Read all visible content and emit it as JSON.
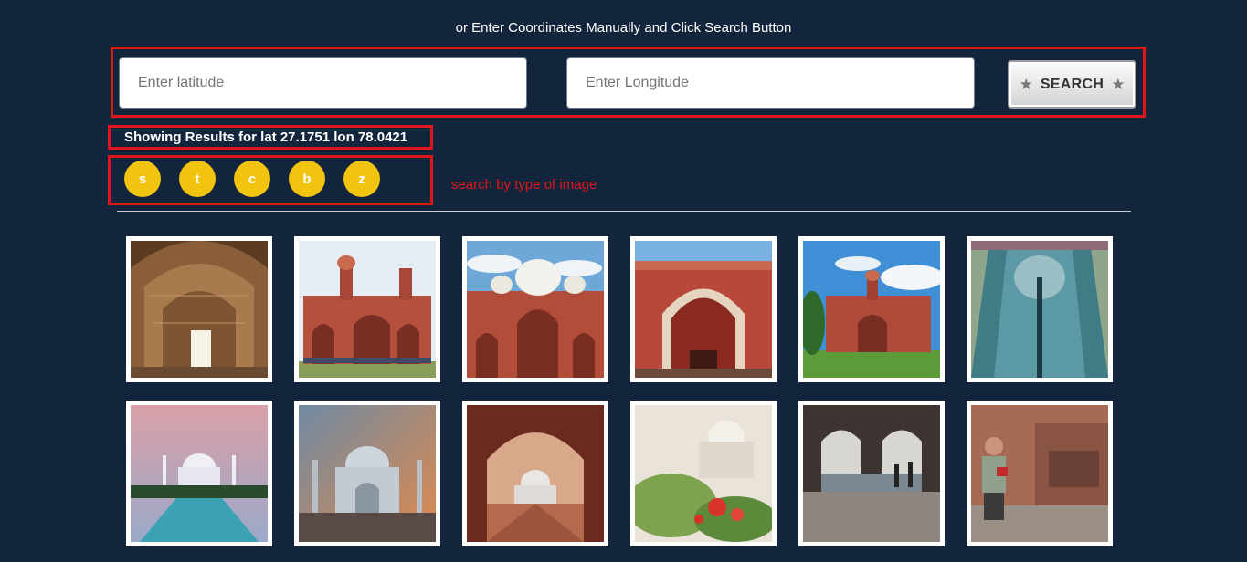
{
  "instruction": "or Enter Coordinates Manually and Click Search Button",
  "search": {
    "lat_placeholder": "Enter latitude",
    "lon_placeholder": "Enter Longitude",
    "button_label": "SEARCH",
    "button_icon": "star-icon"
  },
  "results_text": "Showing Results for lat 27.1751 lon 78.0421",
  "image_types": [
    "s",
    "t",
    "c",
    "b",
    "z"
  ],
  "type_hint": "search by type of image",
  "colors": {
    "background": "#13253c",
    "highlight_border": "#e0161b",
    "type_button": "#f2c40f"
  },
  "gallery": [
    "arched-interior-image",
    "red-sandstone-mosque-image",
    "red-fort-with-domes-image",
    "great-gate-closeup-image",
    "red-building-on-lawn-image",
    "reflection-pool-image",
    "taj-mahal-reflection-image",
    "taj-mahal-sunset-image",
    "taj-through-archway-image",
    "blurred-taj-with-flowers-image",
    "pavilion-view-image",
    "woman-by-ruins-image"
  ]
}
